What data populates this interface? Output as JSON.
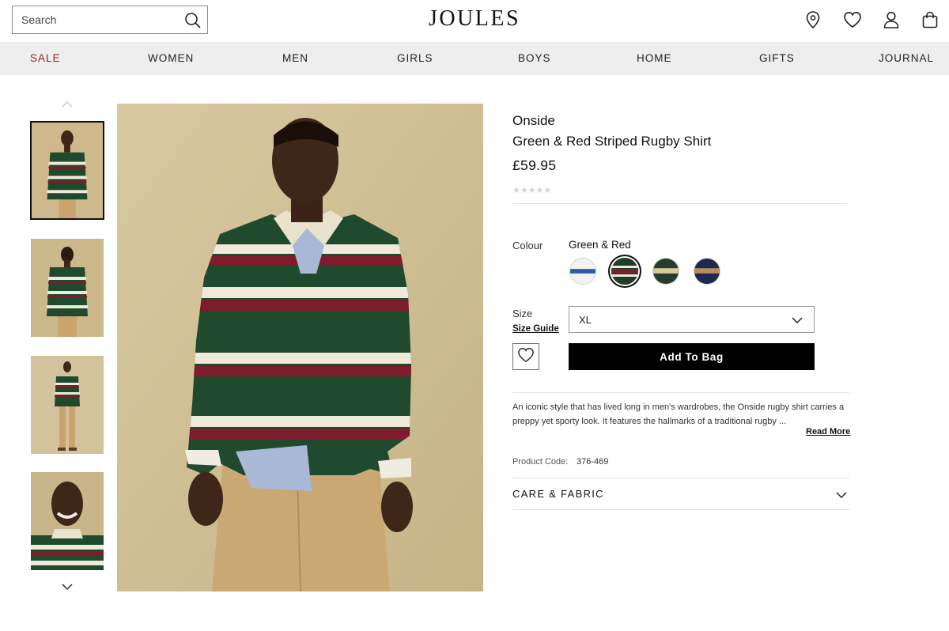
{
  "header": {
    "search_placeholder": "Search",
    "logo": "JOULES",
    "icons": [
      "location-pin-icon",
      "heart-icon",
      "user-icon",
      "bag-icon"
    ]
  },
  "nav": {
    "items": [
      "SALE",
      "WOMEN",
      "MEN",
      "GIRLS",
      "BOYS",
      "HOME",
      "GIFTS",
      "JOURNAL"
    ],
    "sale_color": "#9b1c1c"
  },
  "gallery": {
    "thumbnails": [
      "front",
      "back",
      "full-length",
      "close-up"
    ],
    "selected_index": 0,
    "up_icon": "chevron-up-icon",
    "down_icon": "chevron-down-icon"
  },
  "product": {
    "brand": "Onside",
    "name": "Green & Red Striped Rugby Shirt",
    "price": "£59.95",
    "rating_stars": "★★★★★",
    "rating_value": 0,
    "colour_label": "Colour",
    "colour_value": "Green & Red",
    "swatches": [
      {
        "name": "White & Blue",
        "base": "#f2f2f0",
        "stripe": "#2e5aa8"
      },
      {
        "name": "Green & Red",
        "base": "#1e3d2a",
        "stripe": "#7a1f2e",
        "selected": true
      },
      {
        "name": "Green & Cream",
        "base": "#243d2c",
        "stripe": "#d9cc9a"
      },
      {
        "name": "Navy & Tan",
        "base": "#1d2a4d",
        "stripe": "#b88d5a"
      }
    ],
    "size_label": "Size",
    "size_guide": "Size Guide",
    "size_value": "XL",
    "add_to_bag": "Add To Bag",
    "description": "An iconic style that has lived long in men's wardrobes, the Onside rugby shirt carries a preppy yet sporty look. It features the hallmarks of a traditional rugby ...",
    "read_more": "Read More",
    "product_code_label": "Product Code:",
    "product_code": "376-469",
    "care_heading": "CARE & FABRIC"
  },
  "colors": {
    "shirt_green": "#1f4a2d",
    "stripe_red": "#7c1c2c",
    "stripe_cream": "#efe9dc",
    "background": "#cfbf92",
    "chino": "#c9a874",
    "button": "#000000"
  }
}
